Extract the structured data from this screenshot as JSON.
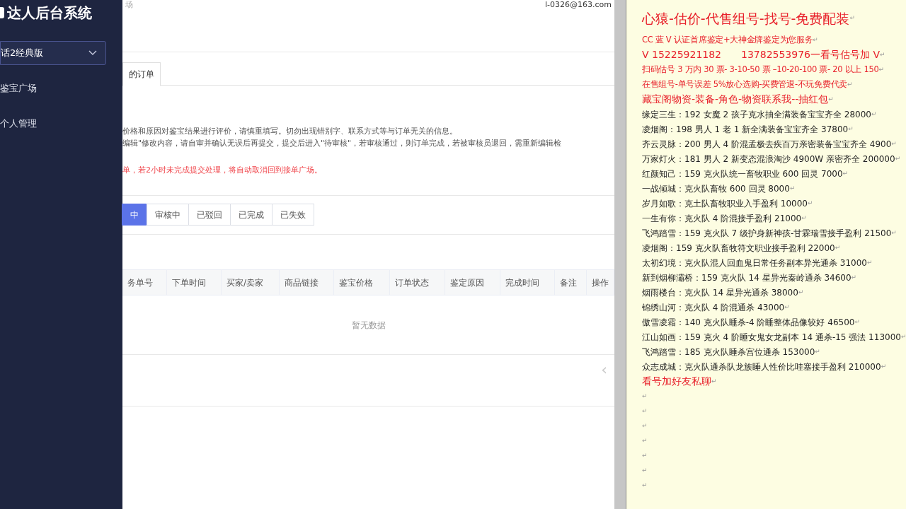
{
  "sidebar": {
    "title": "达人后台系统",
    "version_select": "话2经典版",
    "items": [
      {
        "label": "鉴宝广场",
        "selected": false
      },
      {
        "label": "个人管理",
        "selected": false
      }
    ]
  },
  "header": {
    "breadcrumb": "场",
    "user": "l-0326@163.com"
  },
  "page_tab": {
    "label": "的订单",
    "selected": true
  },
  "notices": [
    {
      "kind": "info",
      "text": "价格和原因对鉴宝结果进行评价，请慎重填写。切勿出现错别字、联系方式等与订单无关的信息。"
    },
    {
      "kind": "info",
      "text": "编辑\"修改内容，请自审并确认无误后再提交，提交后进入\"待审核\"，若审核通过，则订单完成，若被审核员退回，需重新编辑检"
    },
    {
      "kind": "warning",
      "text": "单，若2小时未完成提交处理，将自动取消回到接单广场。"
    }
  ],
  "status_tabs": [
    {
      "label": "中",
      "selected": true
    },
    {
      "label": "审核中",
      "selected": false
    },
    {
      "label": "已驳回",
      "selected": false
    },
    {
      "label": "已完成",
      "selected": false
    },
    {
      "label": "已失效",
      "selected": false
    }
  ],
  "table": {
    "columns": [
      "务单号",
      "下单时间",
      "买家/卖家",
      "商品链接",
      "鉴宝价格",
      "订单状态",
      "鉴定原因",
      "完成时间",
      "备注",
      "操作"
    ],
    "empty": "暂无数据"
  },
  "pagination": {
    "prev": "‹"
  },
  "document": {
    "lines": [
      {
        "kind": "title",
        "text": "心猿-估价-代售组号-找号-免费配装",
        "mark": "↵"
      },
      {
        "kind": "red",
        "text": "CC 蓝 V 认证首席鉴定+大神金牌鉴定为您服务",
        "mark": "↵"
      },
      {
        "kind": "red-large",
        "text": "V 15225921182　　13782553976一看号估号加 V",
        "mark": "↵"
      },
      {
        "kind": "red",
        "text": "扫码估号 3 万内 30 票- 3-10-50 票  –10-20-100 票- 20 以上 150",
        "mark": "↵"
      },
      {
        "kind": "red",
        "text": "在售组号-单号误差 5%放心选购-买费管退-不玩免费代卖",
        "mark": "↵"
      },
      {
        "kind": "red-large",
        "text": "藏宝阁物资-装备-角色-物资联系我--抽红包",
        "mark": "↵"
      },
      {
        "kind": "normal",
        "text": "缘定三生：192 女魔 2 孩子克水抽全满装备宝宝齐全 28000",
        "mark": "↵"
      },
      {
        "kind": "normal",
        "text": "凌烟阁：198 男人 1 老 1 新全满装备宝宝齐全 37800",
        "mark": "↵"
      },
      {
        "kind": "normal",
        "text": "齐云灵脉：200 男人 4 阶混孟极去疾百万亲密装备宝宝齐全 4900",
        "mark": "↵"
      },
      {
        "kind": "normal",
        "text": "万家灯火：181 男人 2 新变态混浪淘沙 4900W 亲密齐全 200000",
        "mark": "↵"
      },
      {
        "kind": "normal",
        "text": "红颜知己：159 克火队统一畜牧职业 600 回灵 7000",
        "mark": "↵"
      },
      {
        "kind": "normal",
        "text": "一战倾城：克火队畜牧 600 回灵 8000",
        "mark": "↵"
      },
      {
        "kind": "normal",
        "text": "岁月如歌：克土队畜牧职业入手盈利 10000",
        "mark": "↵"
      },
      {
        "kind": "normal",
        "text": "一生有你：克火队 4 阶混接手盈利 21000",
        "mark": "↵"
      },
      {
        "kind": "normal",
        "text": "飞鸿踏雪：159 克火队 7 级护身新神孩-甘霖瑞雪接手盈利 21500",
        "mark": "↵"
      },
      {
        "kind": "normal",
        "text": "凌烟阁：159 克火队畜牧符文职业接手盈利 22000",
        "mark": "↵"
      },
      {
        "kind": "normal",
        "text": "太初幻境：克火队混人回血鬼日常任务副本异光通杀 31000",
        "mark": "↵"
      },
      {
        "kind": "normal",
        "text": "新到烟柳灞桥：159 克火队 14 星异光秦岭通杀 34600",
        "mark": "↵"
      },
      {
        "kind": "normal",
        "text": "烟雨楼台：克火队 14 星异光通杀 38000",
        "mark": "↵"
      },
      {
        "kind": "normal",
        "text": "锦绣山河：克火队 4 阶混通杀 43000",
        "mark": "↵"
      },
      {
        "kind": "normal",
        "text": "傲雪凌霜：140 克火队睡杀-4 阶睡整体品像较好 46500",
        "mark": "↵"
      },
      {
        "kind": "normal",
        "text": "江山如画：159 克火 4 阶睡女鬼女龙副本 14 通杀-15 强法 113000",
        "mark": "↵"
      },
      {
        "kind": "normal",
        "text": "飞鸿踏雪：185 克火队睡杀宫位通杀 153000",
        "mark": "↵"
      },
      {
        "kind": "normal",
        "text": "众志成城：克火队通杀队龙族睡人性价比哇塞接手盈利 210000",
        "mark": "↵"
      },
      {
        "kind": "red-large",
        "text": "看号加好友私聊",
        "mark": "↵"
      },
      {
        "kind": "empty",
        "mark": "↵"
      },
      {
        "kind": "empty",
        "mark": "↵"
      },
      {
        "kind": "empty",
        "mark": "↵"
      },
      {
        "kind": "empty",
        "mark": "↵"
      },
      {
        "kind": "empty",
        "mark": "↵"
      },
      {
        "kind": "empty",
        "mark": "↵"
      },
      {
        "kind": "empty",
        "mark": "↵"
      }
    ]
  }
}
